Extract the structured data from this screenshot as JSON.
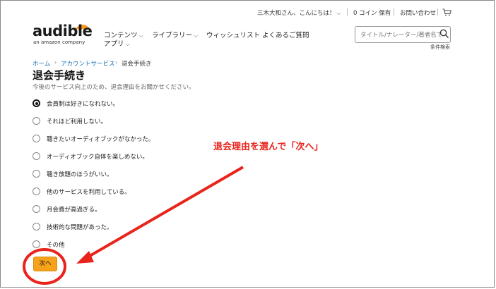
{
  "header": {
    "greeting": "三木大和さん、こんにちは！",
    "coins": "0 コイン 保有",
    "contact": "お問い合わせ"
  },
  "logo": {
    "word": "audible",
    "sub": "an amazon company"
  },
  "nav": {
    "items": [
      {
        "label": "コンテンツ"
      },
      {
        "label": "アプリ"
      },
      {
        "label": "ライブラリー"
      },
      {
        "label": "ウィッシュリスト"
      },
      {
        "label": "よくあるご質問"
      }
    ]
  },
  "search": {
    "placeholder": "タイトル/ナレーター/著者名で",
    "advanced": "条件検索"
  },
  "breadcrumb": {
    "home": "ホーム",
    "account": "アカウントサービス",
    "current": "退会手続き"
  },
  "page": {
    "title": "退会手続き",
    "subtitle": "今後のサービス向上のため、退会理由をお聞かせください。"
  },
  "reasons": [
    {
      "label": "会員制は好きになれない。",
      "selected": true
    },
    {
      "label": "それほど利用しない。",
      "selected": false
    },
    {
      "label": "聴きたいオーディオブックがなかった。",
      "selected": false
    },
    {
      "label": "オーディオブック自体を楽しめない。",
      "selected": false
    },
    {
      "label": "聴き放題のほうがいい。",
      "selected": false
    },
    {
      "label": "他のサービスを利用している。",
      "selected": false
    },
    {
      "label": "月会費が高過ぎる。",
      "selected": false
    },
    {
      "label": "技術的な問題があった。",
      "selected": false
    },
    {
      "label": "その他",
      "selected": false
    }
  ],
  "next_button": {
    "label": "次へ"
  },
  "annotation": {
    "text": "退会理由を選んで「次へ」",
    "color": "#e8241c"
  },
  "colors": {
    "accent": "#f7a21b",
    "link": "#1a6fb5",
    "logo_orange": "#f7991c"
  }
}
